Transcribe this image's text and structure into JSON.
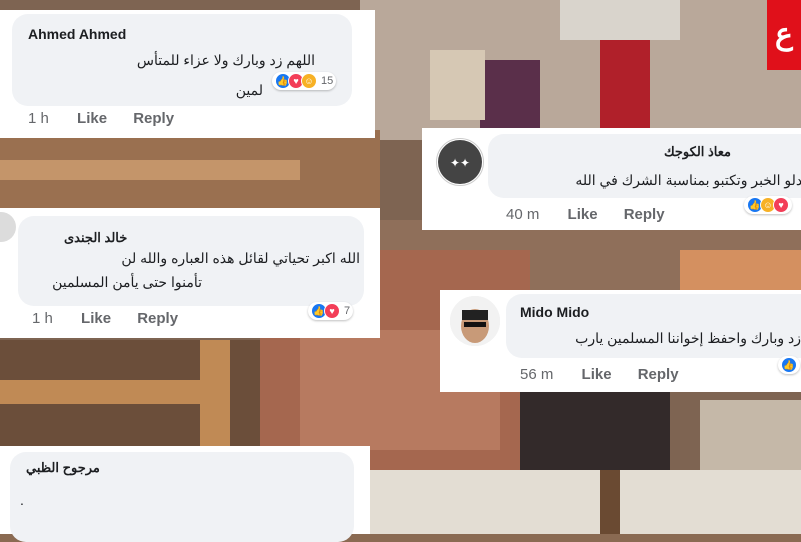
{
  "comments": [
    {
      "name": "Ahmed Ahmed",
      "text_line1": "اللهم زد وبارك ولا عزاء للمتأس",
      "text_line2": "لمين",
      "reaction_count": "15",
      "time": "1 h",
      "like_label": "Like",
      "reply_label": "Reply"
    },
    {
      "name": "معاذ الكوجك",
      "text_line1": "يم تعدلو الخبر وتكتبو بمناسبة الشرك في الله",
      "time": "40 m",
      "like_label": "Like",
      "reply_label": "Reply"
    },
    {
      "name": "خالد الجندى",
      "text_line1": "الله اكبر  تحياتي لقائل هذه العباره والله لن",
      "text_line2": "تأمنوا حتى يأمن المسلمين",
      "reaction_count": "7",
      "time": "1 h",
      "like_label": "Like",
      "reply_label": "Reply"
    },
    {
      "name": "Mido Mido",
      "text_line1": "زد وبارك واحفظ إخواننا المسلمين يارب",
      "time": "56 m",
      "like_label": "Like",
      "reply_label": "Reply"
    },
    {
      "name": "مرجوح الظبي",
      "text_line1": "."
    }
  ],
  "logo_text": "ع",
  "colors": {
    "accent": "#1877f2",
    "bubble": "#f0f2f5",
    "brand_red": "#e0101a"
  },
  "icons": [
    "like-icon",
    "love-icon",
    "haha-icon",
    "avatar-icon"
  ]
}
